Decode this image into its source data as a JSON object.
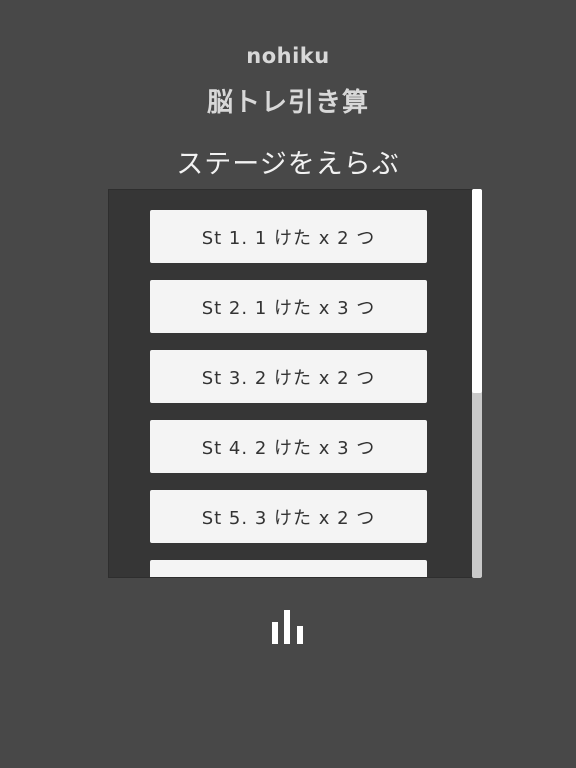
{
  "header": {
    "brand": "nohiku",
    "app_title": "脳トレ引き算"
  },
  "stage_select": {
    "heading": "ステージをえらぶ",
    "stages": [
      {
        "label": "St 1. 1 けた x  2 つ"
      },
      {
        "label": "St 2. 1 けた x  3 つ"
      },
      {
        "label": "St 3. 2 けた x  2 つ"
      },
      {
        "label": "St 4. 2 けた x  3 つ"
      },
      {
        "label": "St 5. 3 けた x  2 つ"
      },
      {
        "label": ""
      }
    ]
  },
  "footer": {
    "icon": "bar-chart-icon"
  },
  "colors": {
    "background": "#484848",
    "list_background": "#363636",
    "button_background": "#f4f4f4",
    "text_light": "#f2f2f2"
  }
}
